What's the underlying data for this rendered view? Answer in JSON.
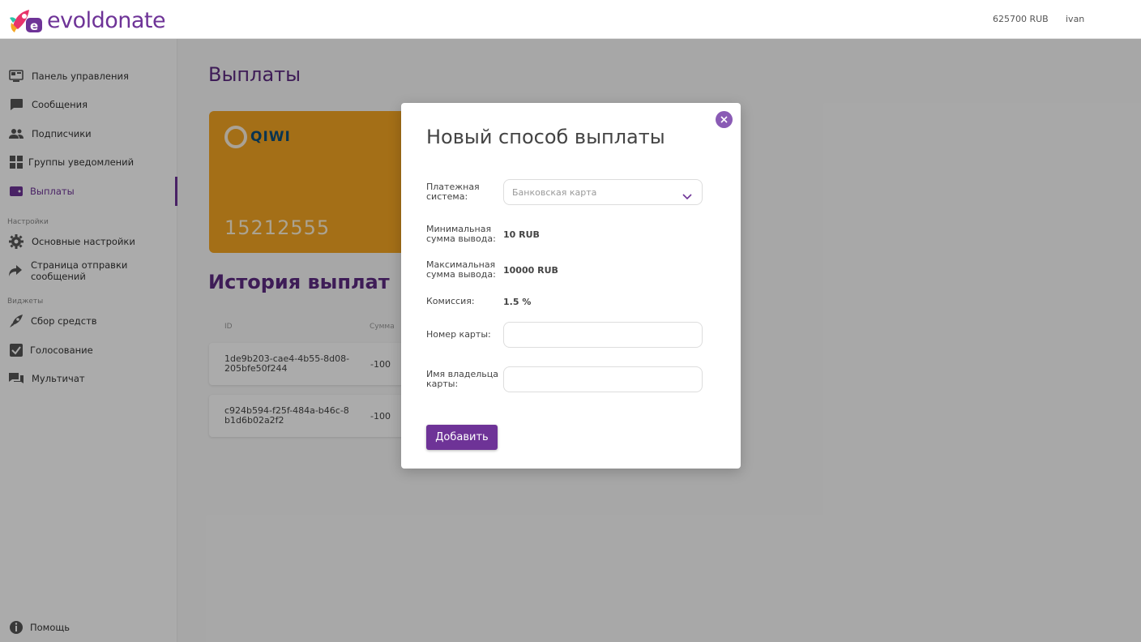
{
  "header": {
    "logo_text": "evoldonate",
    "balance": "625700 RUB",
    "username": "ivan"
  },
  "sidebar": {
    "items": [
      {
        "label": "Панель управления",
        "icon": "dashboard-icon"
      },
      {
        "label": "Сообщения",
        "icon": "chat-bubble-icon"
      },
      {
        "label": "Подписчики",
        "icon": "users-icon"
      },
      {
        "label": "Группы уведомлений",
        "icon": "grid-icon"
      },
      {
        "label": "Выплаты",
        "icon": "wallet-icon",
        "active": true
      }
    ],
    "settings_label": "Настройки",
    "settings_items": [
      {
        "label": "Основные настройки",
        "icon": "gear-icon"
      },
      {
        "label": "Страница отправки сообщений",
        "icon": "share-arrow-icon"
      }
    ],
    "widgets_label": "Виджеты",
    "widget_items": [
      {
        "label": "Сбор средств",
        "icon": "rocket-icon"
      },
      {
        "label": "Голосование",
        "icon": "checkbox-icon"
      },
      {
        "label": "Мультичат",
        "icon": "multichat-icon"
      }
    ],
    "help": {
      "label": "Помощь",
      "icon": "info-icon"
    }
  },
  "main": {
    "title": "Выплаты",
    "card": {
      "brand": "QIWI",
      "number": "15212555",
      "color": "#f5a623"
    },
    "history_title": "История выплат",
    "columns": [
      "ID",
      "Сумма"
    ],
    "rows": [
      {
        "id": "1de9b203-cae4-4b55-8d08-205bfe50f244",
        "amount": "-100"
      },
      {
        "id": "c924b594-f25f-484a-b46c-8b1d6b02a2f2",
        "amount": "-100"
      }
    ]
  },
  "modal": {
    "title": "Новый способ выплаты",
    "payment_system_label": "Платежная система:",
    "payment_system_value": "Банковская карта",
    "min_label": "Минимальная сумма вывода:",
    "min_value": "10 RUB",
    "max_label": "Максимальная сумма вывода:",
    "max_value": "10000 RUB",
    "commission_label": "Комиссия:",
    "commission_value": "1.5 %",
    "card_number_label": "Номер карты:",
    "card_number_value": "",
    "owner_label": "Имя владельца карты:",
    "owner_value": "",
    "submit_label": "Добавить"
  },
  "colors": {
    "accent": "#6e3397",
    "card": "#f5a623",
    "close": "#8a5bb5"
  }
}
